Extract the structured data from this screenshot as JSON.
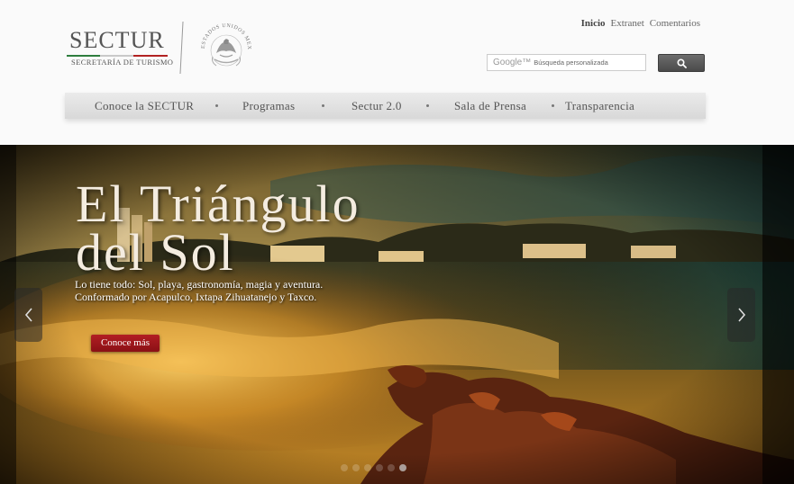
{
  "brand": {
    "name": "SECTUR",
    "subtitle": "SECRETARÍA DE TURISMO",
    "seal_text": "ESTADOS UNIDOS MEXICANOS"
  },
  "util_nav": {
    "items": [
      "Inicio",
      "Extranet",
      "Comentarios"
    ],
    "active": "Inicio"
  },
  "search": {
    "brand": "Google™",
    "placeholder": "Búsqueda personalizada",
    "button_icon": "magnifier-icon"
  },
  "main_nav": {
    "items": [
      "Conoce la SECTUR",
      "Programas",
      "Sectur 2.0",
      "Sala de Prensa",
      "Transparencia"
    ]
  },
  "hero": {
    "title_line1": "El Triángulo",
    "title_line2": "del Sol",
    "description_line1": "Lo tiene todo: Sol, playa, gastronomía, magia y aventura.",
    "description_line2": "Conformado por Acapulco, Ixtapa Zihuatanejo y Taxco.",
    "cta_label": "Conoce más",
    "prev_icon": "chevron-left-icon",
    "next_icon": "chevron-right-icon",
    "slide_count": 6,
    "active_slide": 6
  },
  "colors": {
    "cta": "#a0181d",
    "nav_text": "#555555",
    "search_button": "#5a5a5a"
  }
}
